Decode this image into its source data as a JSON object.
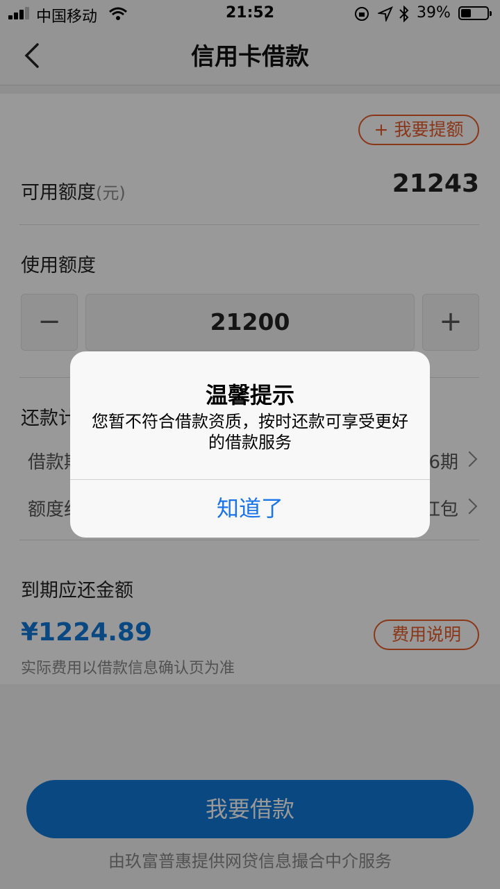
{
  "status_bar": {
    "carrier": "中国移动",
    "time": "21:52",
    "battery": "39%",
    "battery_level": 0.39
  },
  "nav": {
    "title": "信用卡借款",
    "back_icon": "chevron-left-icon"
  },
  "limit": {
    "raise_button": "+ 我要提额",
    "available_label": "可用额度",
    "available_unit": "(元)",
    "available_value": "21243"
  },
  "usage": {
    "label": "使用额度",
    "minus": "−",
    "plus": "+",
    "amount": "21200"
  },
  "repayment": {
    "section_label_partial": "还款计",
    "row1_label_partial": "借款期",
    "row1_value_partial": "6期",
    "row2_label_partial": "额度红",
    "row2_value_partial": "红包"
  },
  "due": {
    "label": "到期应还金额",
    "amount": "¥1224.89",
    "fee_button": "费用说明",
    "note": "实际费用以借款信息确认页为准"
  },
  "primary_button": "我要借款",
  "footer": "由玖富普惠提供网贷信息撮合中介服务",
  "dialog": {
    "title": "温馨提示",
    "message": "您暂不符合借款资质，按时还款可享受更好的借款服务",
    "confirm": "知道了"
  },
  "colors": {
    "accent_blue": "#1279d8",
    "accent_orange": "#e55a2a",
    "dialog_button_blue": "#1a73e8"
  }
}
